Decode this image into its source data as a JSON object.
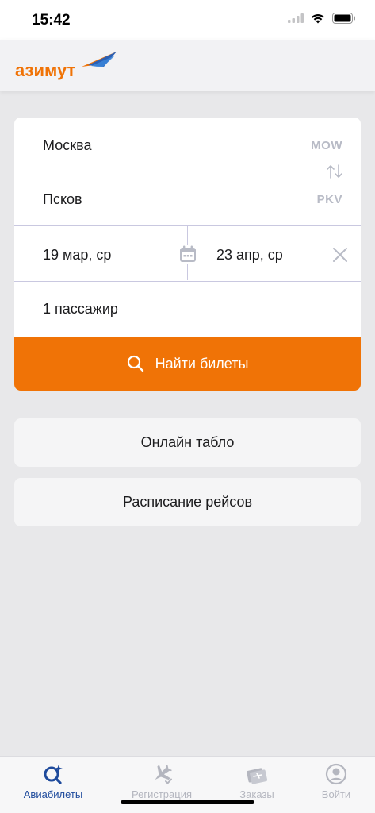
{
  "status_bar": {
    "time": "15:42"
  },
  "header": {
    "logo_text": "азимут"
  },
  "search": {
    "from_city": "Москва",
    "from_code": "MOW",
    "to_city": "Псков",
    "to_code": "PKV",
    "date_depart": "19 мар, ср",
    "date_return": "23 апр, ср",
    "passengers": "1 пассажир",
    "search_button_label": "Найти билеты"
  },
  "menu": {
    "online_board_label": "Онлайн табло",
    "schedule_label": "Расписание рейсов"
  },
  "tabs": [
    {
      "label": "Авиабилеты",
      "icon": "ticket-search-icon",
      "active": true
    },
    {
      "label": "Регистрация",
      "icon": "checkin-plane-icon",
      "active": false
    },
    {
      "label": "Заказы",
      "icon": "orders-icon",
      "active": false
    },
    {
      "label": "Войти",
      "icon": "profile-icon",
      "active": false
    }
  ],
  "colors": {
    "accent_orange": "#f07306",
    "active_tab_blue": "#1e4a9c",
    "inactive_gray": "#b4b6bf"
  }
}
